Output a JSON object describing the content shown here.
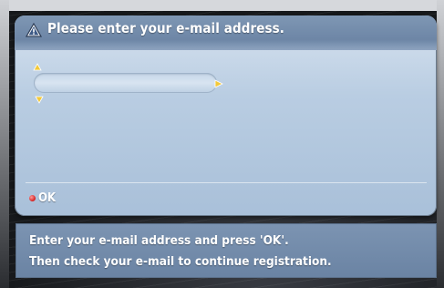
{
  "dialog": {
    "title": "Please enter your e-mail address.",
    "title_icon": "warning-triangle-icon",
    "email_field": {
      "value": "",
      "placeholder": ""
    },
    "ok_label": "OK"
  },
  "info": {
    "line1": "Enter your e-mail address and press 'OK'.",
    "line2": "Then check your e-mail to continue registration."
  },
  "colors": {
    "dialog_background": "#b9cde2",
    "title_bar": "#6d86a6",
    "info_panel": "#6a83a3",
    "arrow_yellow": "#f3c93a",
    "ok_dot": "#d21e1e"
  }
}
